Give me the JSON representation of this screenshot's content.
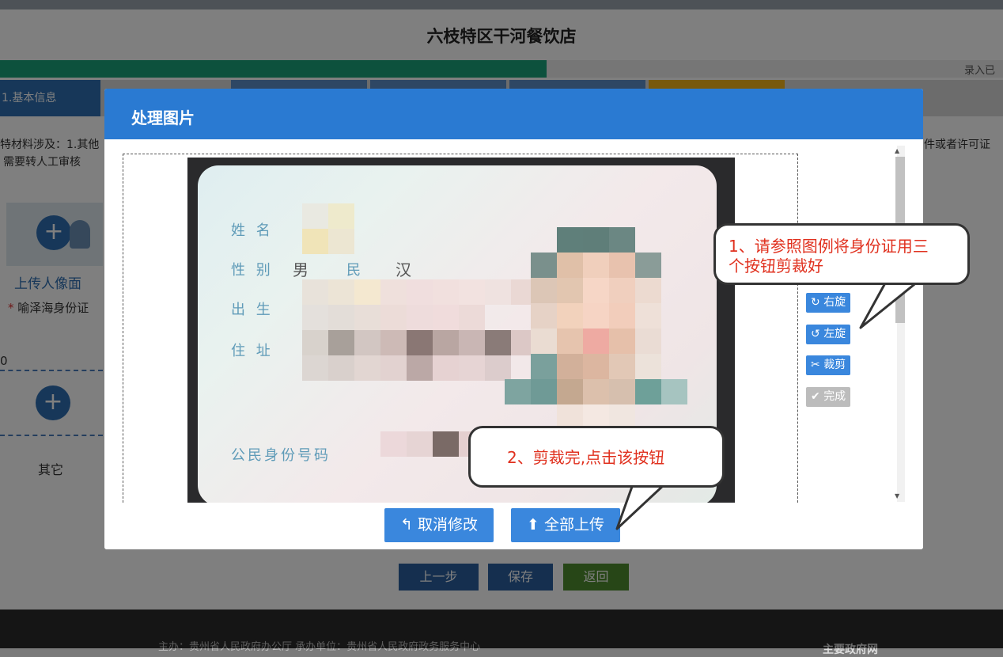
{
  "site": {
    "title": "六枝特区干河餐饮店",
    "progress_text": "录入已",
    "progress_ratio": 0.545
  },
  "steps": [
    {
      "label": "1.基本信息"
    }
  ],
  "notice": {
    "left_line1": "特材料涉及：1.其他",
    "left_line2": "需要转人工审核",
    "right": "件或者许可证"
  },
  "upload": {
    "avatar_label": "上传人像面",
    "id_label": "喻泽海身份证",
    "id_required_mark": "*",
    "zero": "0",
    "other_label": "其它"
  },
  "page_buttons": {
    "prev": "上一步",
    "save": "保存",
    "back": "返回"
  },
  "footer": {
    "text": "主办：贵州省人民政府办公厅  承办单位：贵州省人民政府政务服务中心",
    "right": "主要政府网"
  },
  "modal": {
    "title": "处理图片",
    "card": {
      "name_field": "姓 名",
      "sex_field": "性 别",
      "sex_value": "男",
      "ethnic_field": "民",
      "ethnic_value": "汉",
      "birth_field": "出 生",
      "address_field": "住 址",
      "id_field": "公民身份号码"
    },
    "tools": {
      "rotate_right": "右旋",
      "rotate_left": "左旋",
      "crop": "裁剪",
      "done": "完成"
    },
    "actions": {
      "cancel": "取消修改",
      "upload_all": "全部上传"
    }
  },
  "callouts": {
    "one": {
      "line1": "1、请参照图例将身份证用三",
      "line2": "个按钮剪裁好"
    },
    "two": {
      "text": "2、剪裁完,点击该按钮"
    }
  },
  "colors": {
    "primary": "#2a7ad2",
    "button": "#3a87dd",
    "callout_text": "#e0301e",
    "progress": "#1aa37a"
  }
}
